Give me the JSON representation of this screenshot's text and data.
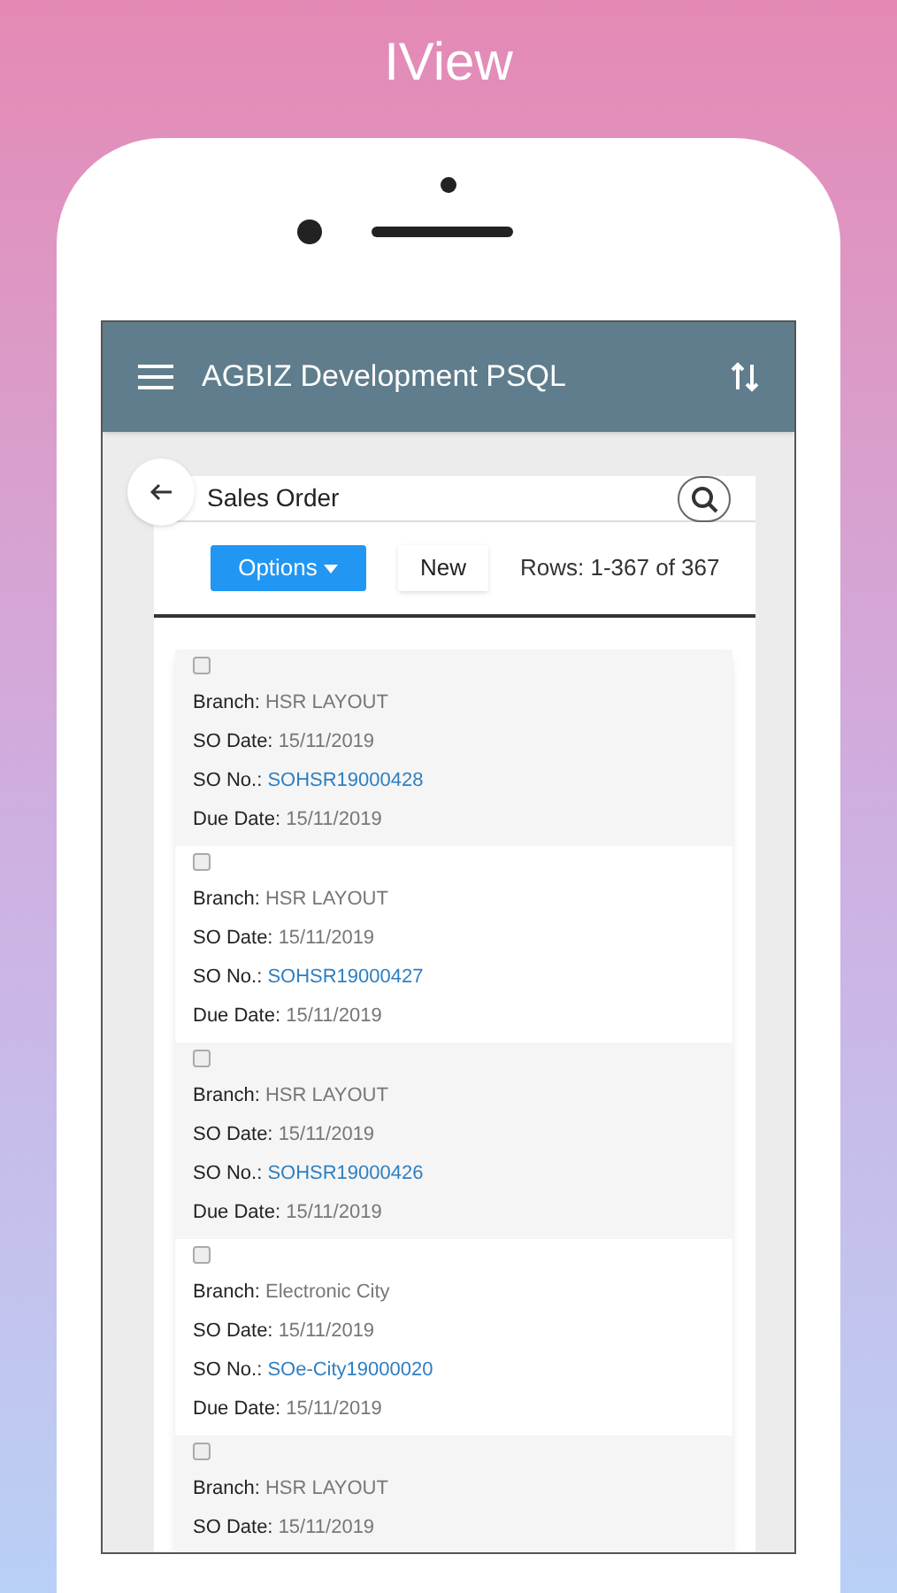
{
  "banner": {
    "title": "IView"
  },
  "app_bar": {
    "title": "AGBIZ Development PSQL"
  },
  "page": {
    "title": "Sales Order"
  },
  "toolbar": {
    "options": "Options",
    "new": "New",
    "rows": "Rows: 1-367 of 367"
  },
  "records": [
    {
      "checked": false,
      "fields": [
        {
          "label": "Branch:",
          "value": "HSR LAYOUT",
          "kind": "text"
        },
        {
          "label": "SO Date:",
          "value": "15/11/2019",
          "kind": "text"
        },
        {
          "label": "SO No.:",
          "value": "SOHSR19000428",
          "kind": "link"
        },
        {
          "label": "Due Date:",
          "value": "15/11/2019",
          "kind": "text"
        }
      ]
    },
    {
      "checked": false,
      "fields": [
        {
          "label": "Branch:",
          "value": "HSR LAYOUT",
          "kind": "text"
        },
        {
          "label": "SO Date:",
          "value": "15/11/2019",
          "kind": "text"
        },
        {
          "label": "SO No.:",
          "value": "SOHSR19000427",
          "kind": "link"
        },
        {
          "label": "Due Date:",
          "value": "15/11/2019",
          "kind": "text"
        }
      ]
    },
    {
      "checked": false,
      "fields": [
        {
          "label": "Branch:",
          "value": "HSR LAYOUT",
          "kind": "text"
        },
        {
          "label": "SO Date:",
          "value": "15/11/2019",
          "kind": "text"
        },
        {
          "label": "SO No.:",
          "value": "SOHSR19000426",
          "kind": "link"
        },
        {
          "label": "Due Date:",
          "value": "15/11/2019",
          "kind": "text"
        }
      ]
    },
    {
      "checked": false,
      "fields": [
        {
          "label": "Branch:",
          "value": "Electronic City",
          "kind": "text"
        },
        {
          "label": "SO Date:",
          "value": "15/11/2019",
          "kind": "text"
        },
        {
          "label": "SO No.:",
          "value": "SOe-City19000020",
          "kind": "link"
        },
        {
          "label": "Due Date:",
          "value": "15/11/2019",
          "kind": "text"
        }
      ]
    },
    {
      "checked": false,
      "fields": [
        {
          "label": "Branch:",
          "value": "HSR LAYOUT",
          "kind": "text"
        },
        {
          "label": "SO Date:",
          "value": "15/11/2019",
          "kind": "text"
        }
      ]
    }
  ]
}
